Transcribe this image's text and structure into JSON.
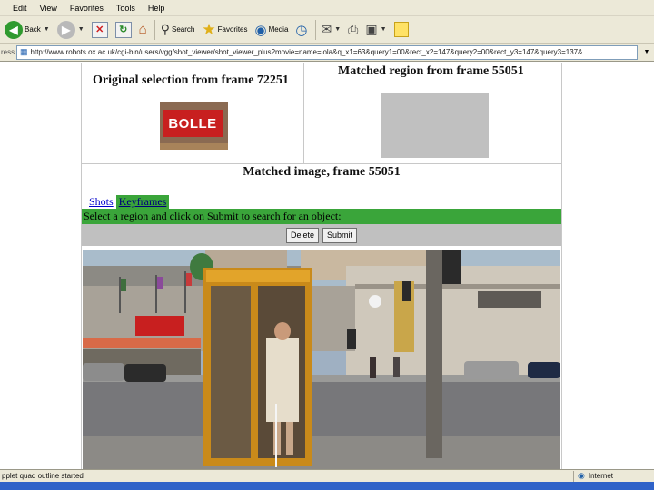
{
  "menu": {
    "items": [
      "Edit",
      "View",
      "Favorites",
      "Tools",
      "Help"
    ]
  },
  "toolbar": {
    "back_label": "Back",
    "search_label": "Search",
    "favorites_label": "Favorites",
    "media_label": "Media"
  },
  "address": {
    "label": "ress",
    "url": "http://www.robots.ox.ac.uk/cgi-bin/users/vgg/shot_viewer/shot_viewer_plus?movie=name=lola&q_x1=63&query1=00&rect_x2=147&query2=00&rect_y3=147&query3=137&"
  },
  "page": {
    "original_title": "Original selection from frame 72251",
    "matched_region_title": "Matched region from frame 55051",
    "thumb_sign_text": "BOLLE",
    "matched_image_title": "Matched image, frame 55051",
    "tabs": [
      {
        "label": "Shots",
        "active": false
      },
      {
        "label": "Keyframes",
        "active": true
      }
    ],
    "instruction": "Select a region and click on Submit to search for an object:",
    "delete_label": "Delete",
    "submit_label": "Submit"
  },
  "status": {
    "text": "pplet quad outline started",
    "zone": "Internet"
  },
  "colors": {
    "green_bar": "#3aa53a",
    "sign_red": "#c81f1f",
    "matched_region_gray": "#c0c0c0"
  },
  "icons": [
    "back-icon",
    "forward-icon",
    "stop-icon",
    "refresh-icon",
    "home-icon",
    "search-icon",
    "favorites-icon",
    "media-icon",
    "history-icon",
    "mail-icon",
    "print-icon",
    "edit-icon",
    "note-icon",
    "page-icon",
    "internet-icon"
  ]
}
